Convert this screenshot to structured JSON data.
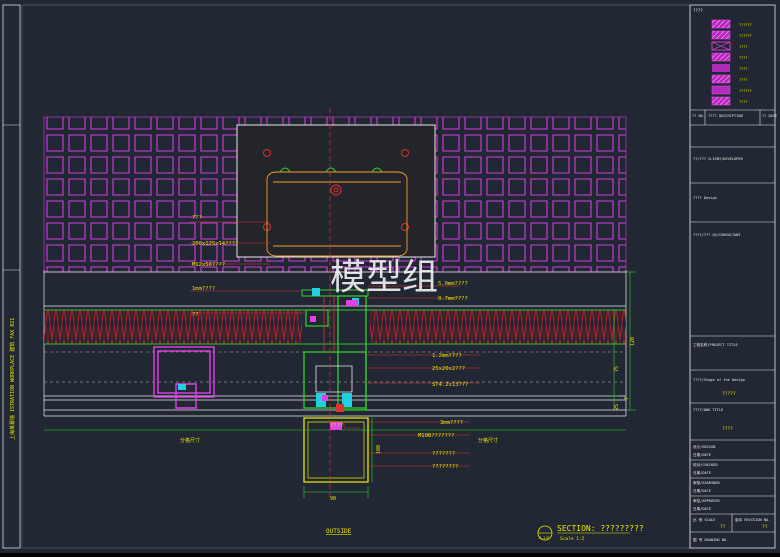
{
  "drawing": {
    "watermark": "模型组",
    "left_strip_text": "上海某幕墙 ISTRATION WORKPLACE 建筑 FAX 021",
    "outside_label": "OUTSIDE",
    "section_title": "SECTION: ?????????",
    "section_scale": "Scale 1:2",
    "section_tag": "E—1/E",
    "annotations": [
      "???",
      "200x125x14????",
      "M12x50????",
      "1mm????",
      "??",
      "5.0mm????",
      "0.7mm????",
      "1.2mm????",
      "25x20x2???",
      "ST4.2x13???",
      "3mm????",
      "M10B???????",
      "???????",
      "????????",
      "????"
    ],
    "dims": {
      "overall": "120",
      "mid": "75",
      "d1": "25",
      "d2": "7",
      "bottom_width": "90",
      "lower_height": "100",
      "left_span": "分格尺寸",
      "right_span": "分格尺寸"
    }
  },
  "title_block": {
    "legend_heading": "????",
    "legend_items": [
      {
        "label": "??????",
        "color": "#ff40ff"
      },
      {
        "label": "??????",
        "color": "#ff40ff"
      },
      {
        "label": "????",
        "color": "#ff40ff"
      },
      {
        "label": "????",
        "color": "#ff40ff"
      },
      {
        "label": "????",
        "color": "#ff40ff"
      },
      {
        "label": "????",
        "color": "#ff40ff"
      },
      {
        "label": "??????",
        "color": "#ff40ff"
      },
      {
        "label": "????",
        "color": "#ff40ff"
      }
    ],
    "rev_no": "?? NO",
    "rev_desc": "???? DESCRIPTION",
    "rev_date": "?? DATE",
    "client": "??/??? CLIENT/DEVELOPER",
    "design": "???? Design",
    "consultant": "????/??? QS/CONSULTANT",
    "project_title": "工程名称/PROJECT TITLE",
    "stage_label": "????/Stage of the Design",
    "stage_value": "?????",
    "dwg_title_label": "????/DWG TITLE",
    "dwg_title_value": "????",
    "design_row": "设计/DESIGN",
    "design_date": "日期/DATE",
    "checked_row": "校对/CHECKED",
    "checked_date": "日期/DATE",
    "examined_row": "审核/EXAMINED",
    "examined_date": "日期/DATE",
    "approved_row": "审定/APPROVED",
    "approved_date": "日期/DATE",
    "scale_label": "比 例 SCALE",
    "scale_value": "??",
    "revision_label": "版本 REVISION NO.",
    "revision_value": "??",
    "drawing_no": "图 号 DRAWING NO."
  }
}
